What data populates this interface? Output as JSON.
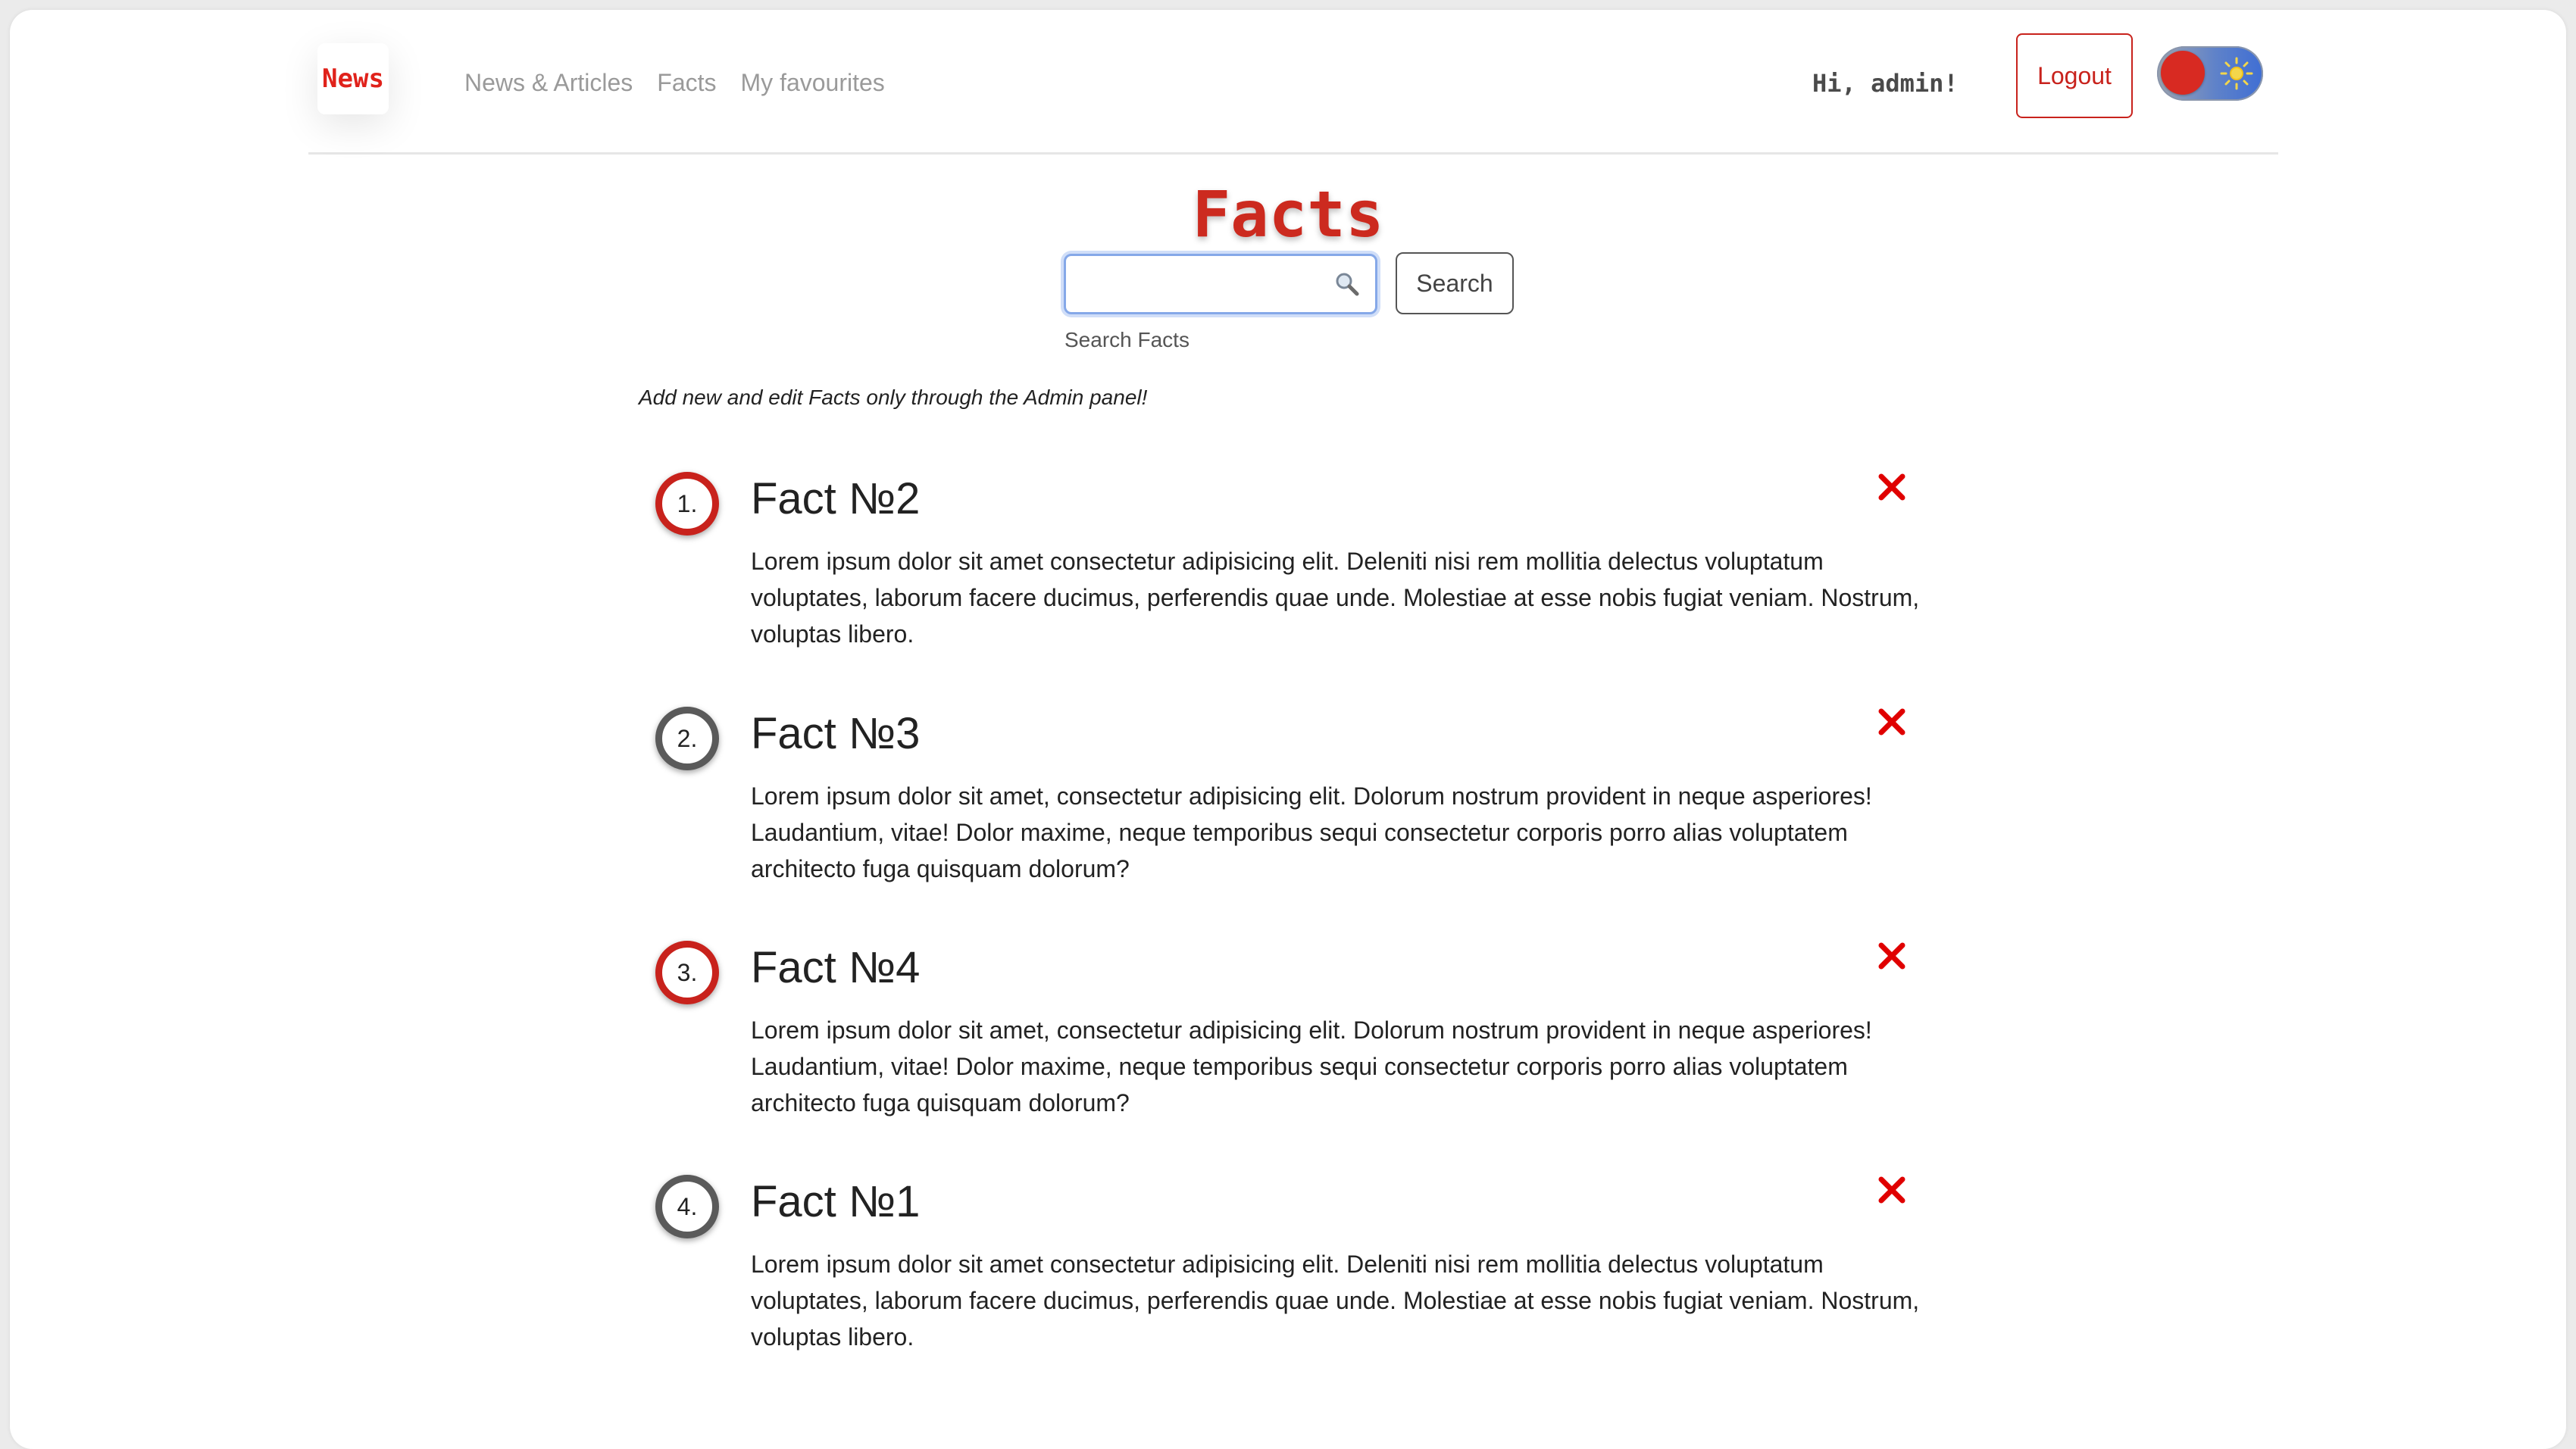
{
  "nav": {
    "brand": "News",
    "links": [
      {
        "label": "News & Articles"
      },
      {
        "label": "Facts"
      },
      {
        "label": "My favourites"
      }
    ],
    "greeting": "Hi, admin!",
    "logout_label": "Logout",
    "theme_toggle": {
      "state": "light",
      "icon": "sun-icon"
    }
  },
  "header": {
    "title": "Facts",
    "search_value": "",
    "search_help": "Search Facts",
    "search_button": "Search",
    "admin_note": "Add new and edit Facts only through the Admin panel!"
  },
  "colors": {
    "accent_red": "#c8221c",
    "ring_grey": "#5a5a5a",
    "delete_red": "#e00000"
  },
  "facts": [
    {
      "number": "1.",
      "title": "Fact №2",
      "text": "Lorem ipsum dolor sit amet consectetur adipisicing elit. Deleniti nisi rem mollitia delectus voluptatum voluptates, laborum facere ducimus, perferendis quae unde. Molestiae at esse nobis fugiat veniam. Nostrum, voluptas libero."
    },
    {
      "number": "2.",
      "title": "Fact №3",
      "text": "Lorem ipsum dolor sit amet, consectetur adipisicing elit. Dolorum nostrum provident in neque asperiores! Laudantium, vitae! Dolor maxime, neque temporibus sequi consectetur corporis porro alias voluptatem architecto fuga quisquam dolorum?"
    },
    {
      "number": "3.",
      "title": "Fact №4",
      "text": "Lorem ipsum dolor sit amet, consectetur adipisicing elit. Dolorum nostrum provident in neque asperiores! Laudantium, vitae! Dolor maxime, neque temporibus sequi consectetur corporis porro alias voluptatem architecto fuga quisquam dolorum?"
    },
    {
      "number": "4.",
      "title": "Fact №1",
      "text": "Lorem ipsum dolor sit amet consectetur adipisicing elit. Deleniti nisi rem mollitia delectus voluptatum voluptates, laborum facere ducimus, perferendis quae unde. Molestiae at esse nobis fugiat veniam. Nostrum, voluptas libero."
    }
  ]
}
